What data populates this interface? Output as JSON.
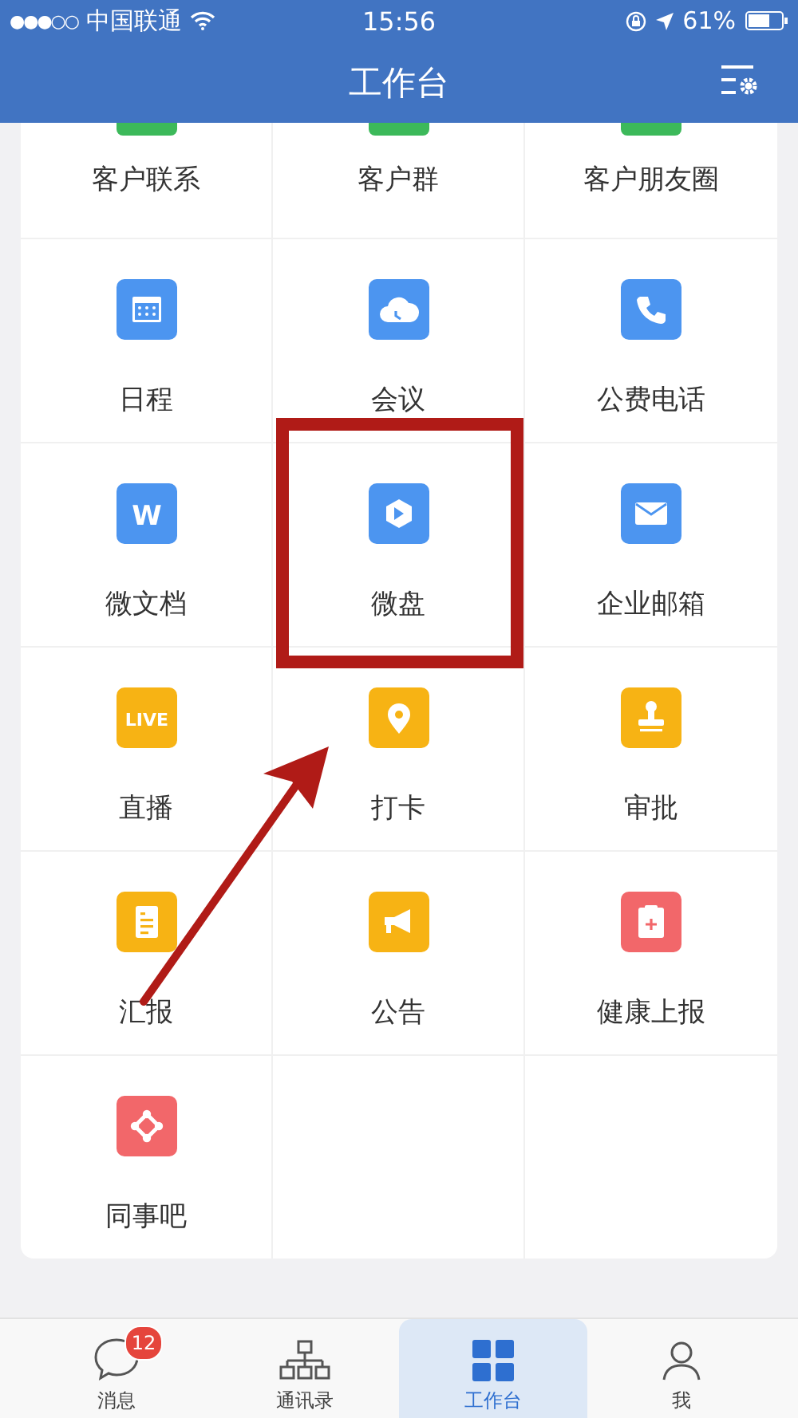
{
  "status_bar": {
    "signal": "●●●○○",
    "carrier": "中国联通",
    "time": "15:56",
    "battery": "61%"
  },
  "header": {
    "title": "工作台"
  },
  "partial_row": [
    {
      "label": "客户联系",
      "color": "#3cb95a"
    },
    {
      "label": "客户群",
      "color": "#3cb95a"
    },
    {
      "label": "客户朋友圈",
      "color": "#3cb95a"
    }
  ],
  "apps": [
    {
      "label": "日程",
      "color": "#4c95f0"
    },
    {
      "label": "会议",
      "color": "#4c95f0"
    },
    {
      "label": "公费电话",
      "color": "#4c95f0"
    },
    {
      "label": "微文档",
      "color": "#4c95f0",
      "icon_text": "W"
    },
    {
      "label": "微盘",
      "color": "#4c95f0"
    },
    {
      "label": "企业邮箱",
      "color": "#4c95f0"
    },
    {
      "label": "直播",
      "color": "#f7b314",
      "icon_text": "LIVE"
    },
    {
      "label": "打卡",
      "color": "#f7b314"
    },
    {
      "label": "审批",
      "color": "#f7b314"
    },
    {
      "label": "汇报",
      "color": "#f7b314"
    },
    {
      "label": "公告",
      "color": "#f7b314"
    },
    {
      "label": "健康上报",
      "color": "#f2676a"
    },
    {
      "label": "同事吧",
      "color": "#f2676a"
    }
  ],
  "tabs": [
    {
      "label": "消息",
      "selected": false,
      "badge": "12"
    },
    {
      "label": "通讯录",
      "selected": false
    },
    {
      "label": "工作台",
      "selected": true
    },
    {
      "label": "我",
      "selected": false
    }
  ]
}
